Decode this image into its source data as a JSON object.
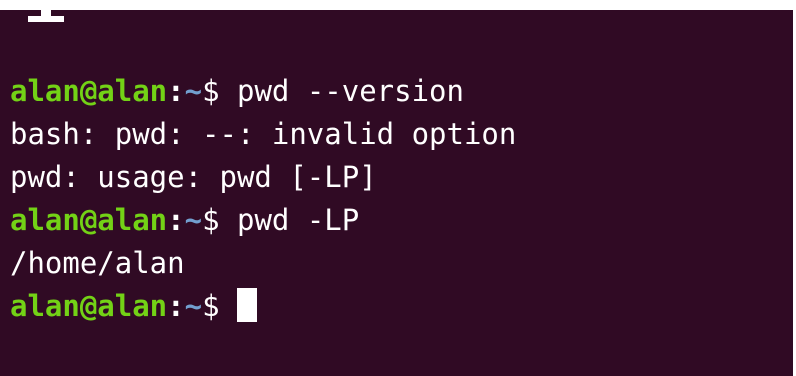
{
  "terminal": {
    "colors": {
      "background": "#300a24",
      "text": "#ffffff",
      "prompt_user": "#73d216",
      "prompt_path": "#729fcf"
    },
    "prompt": {
      "user_host": "alan@alan",
      "separator": ":",
      "path": "~",
      "symbol": "$ "
    },
    "lines": [
      {
        "type": "command",
        "command": "pwd --version"
      },
      {
        "type": "output",
        "text": "bash: pwd: --: invalid option"
      },
      {
        "type": "output",
        "text": "pwd: usage: pwd [-LP]"
      },
      {
        "type": "command",
        "command": "pwd -LP"
      },
      {
        "type": "output",
        "text": "/home/alan"
      },
      {
        "type": "command",
        "command": ""
      }
    ]
  }
}
